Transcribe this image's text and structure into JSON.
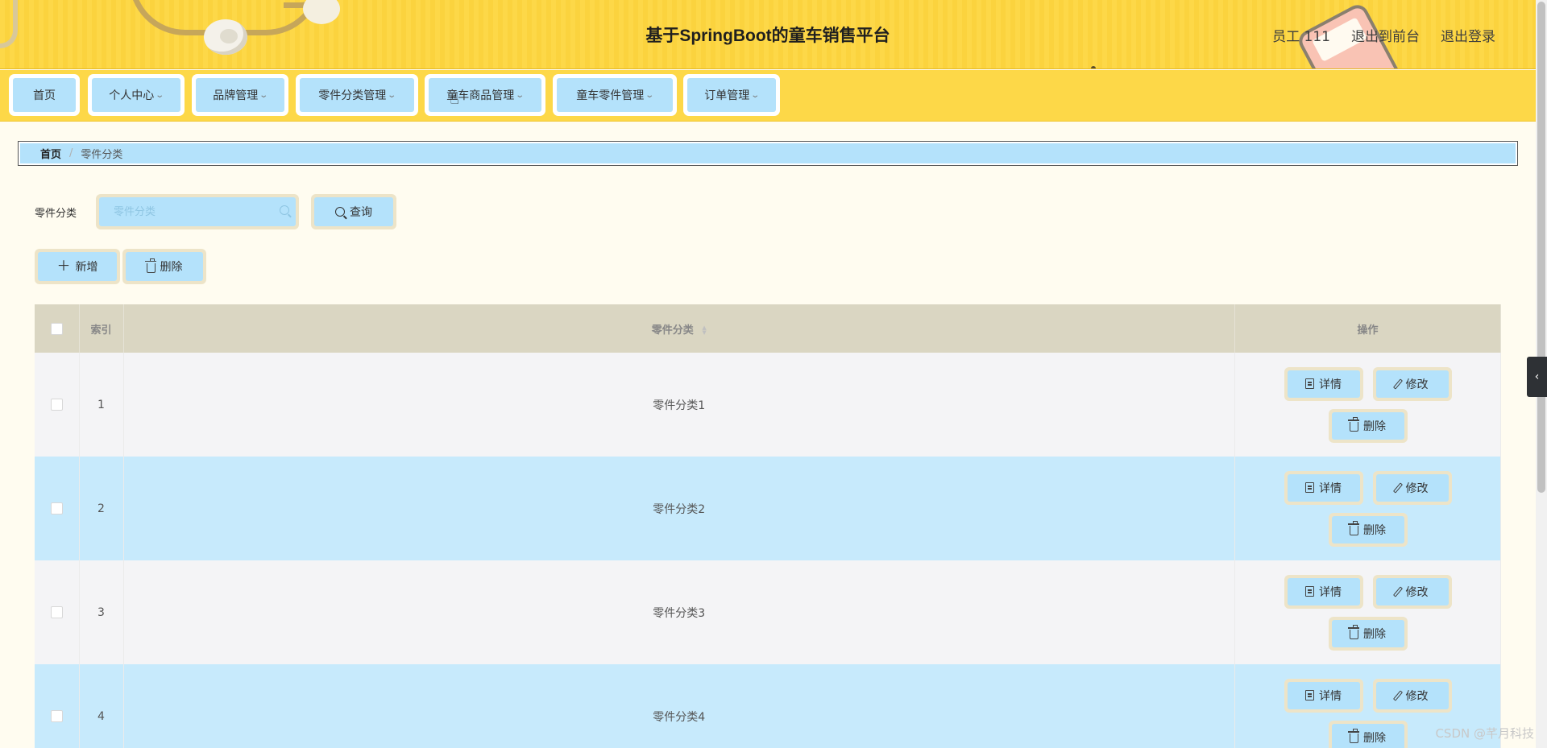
{
  "header": {
    "title": "基于SpringBoot的童车销售平台",
    "user": "员工 111",
    "to_front": "退出到前台",
    "logout": "退出登录"
  },
  "nav": {
    "items": [
      {
        "label": "首页",
        "has_dropdown": false
      },
      {
        "label": "个人中心",
        "has_dropdown": true
      },
      {
        "label": "品牌管理",
        "has_dropdown": true
      },
      {
        "label": "零件分类管理",
        "has_dropdown": true
      },
      {
        "label": "童车商品管理",
        "has_dropdown": true
      },
      {
        "label": "童车零件管理",
        "has_dropdown": true
      },
      {
        "label": "订单管理",
        "has_dropdown": true
      }
    ]
  },
  "breadcrumb": {
    "home": "首页",
    "separator": "/",
    "current": "零件分类"
  },
  "search": {
    "label": "零件分类",
    "placeholder": "零件分类",
    "value": "",
    "button": "查询"
  },
  "actions": {
    "add": "新增",
    "delete": "删除"
  },
  "table": {
    "headers": {
      "index": "索引",
      "category": "零件分类",
      "ops": "操作"
    },
    "rows": [
      {
        "index": "1",
        "category": "零件分类1"
      },
      {
        "index": "2",
        "category": "零件分类2"
      },
      {
        "index": "3",
        "category": "零件分类3"
      },
      {
        "index": "4",
        "category": "零件分类4"
      }
    ],
    "ops_labels": {
      "detail": "详情",
      "edit": "修改",
      "delete": "删除"
    }
  },
  "watermark": "CSDN @芊月科技",
  "colors": {
    "header_bg": "#fdd848",
    "button_bg": "#b4e2fb",
    "button_border": "#ede4c8",
    "row_alt": "#c7eafc",
    "table_header": "#dad6c2",
    "page_bg": "#fffcf0"
  }
}
